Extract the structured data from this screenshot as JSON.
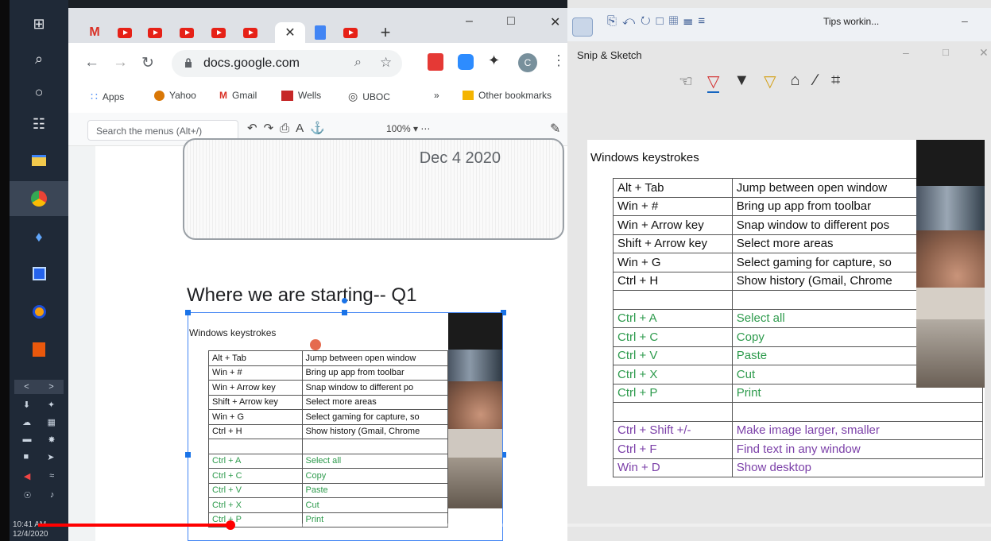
{
  "taskbar": {
    "icons": [
      "windows-start",
      "search",
      "cortana",
      "task-view",
      "file-explorer",
      "chrome",
      "app-blue",
      "app-notes",
      "app-headphones",
      "app-orange"
    ],
    "clock_time": "10:41 AM",
    "clock_date": "12/4/2020"
  },
  "chrome": {
    "url": "docs.google.com",
    "bookmarks": [
      "Apps",
      "Yahoo",
      "Gmail",
      "Wells",
      "UBOC",
      "»",
      "Other bookmarks"
    ],
    "avatar_letter": "C",
    "docs_search_placeholder": "Search the menus (Alt+/)",
    "zoom": "100%",
    "doc_date": "Dec 4 2020",
    "section_title": "Where we are starting-- Q1",
    "table_title": "Windows keystrokes"
  },
  "snip": {
    "app_title": "Snip & Sketch",
    "doc_tab_title": "Tips workin...",
    "heading": "Windows keystrokes"
  },
  "left_rows": [
    {
      "k": "Alt + Tab",
      "v": "Jump between open window",
      "c": "black"
    },
    {
      "k": "Win + #",
      "v": "Bring up app from toolbar",
      "c": "black"
    },
    {
      "k": "Win + Arrow key",
      "v": "Snap window to different po",
      "c": "black"
    },
    {
      "k": "Shift + Arrow key",
      "v": "Select more areas",
      "c": "black"
    },
    {
      "k": "Win + G",
      "v": "Select gaming for capture, so",
      "c": "black"
    },
    {
      "k": "Ctrl + H",
      "v": "Show history (Gmail, Chrome",
      "c": "black"
    },
    {
      "k": "",
      "v": "",
      "c": "black"
    },
    {
      "k": "Ctrl + A",
      "v": "Select all",
      "c": "green"
    },
    {
      "k": "Ctrl + C",
      "v": "Copy",
      "c": "green"
    },
    {
      "k": "Ctrl + V",
      "v": "Paste",
      "c": "green"
    },
    {
      "k": "Ctrl + X",
      "v": "Cut",
      "c": "green"
    },
    {
      "k": "Ctrl + P",
      "v": "Print",
      "c": "green"
    }
  ],
  "right_rows": [
    {
      "k": "Alt + Tab",
      "v": "Jump between open window",
      "c": "black"
    },
    {
      "k": "Win + #",
      "v": "Bring up app from toolbar",
      "c": "black"
    },
    {
      "k": "Win + Arrow key",
      "v": "Snap window to different pos",
      "c": "black"
    },
    {
      "k": "Shift + Arrow key",
      "v": "Select more areas",
      "c": "black"
    },
    {
      "k": "Win + G",
      "v": "Select gaming for capture, so",
      "c": "black"
    },
    {
      "k": "Ctrl + H",
      "v": "Show history (Gmail, Chrome",
      "c": "black"
    },
    {
      "k": "",
      "v": "",
      "c": "black"
    },
    {
      "k": "Ctrl + A",
      "v": "Select all",
      "c": "green"
    },
    {
      "k": "Ctrl + C",
      "v": "Copy",
      "c": "green"
    },
    {
      "k": "Ctrl + V",
      "v": "Paste",
      "c": "green"
    },
    {
      "k": "Ctrl + X",
      "v": "Cut",
      "c": "green"
    },
    {
      "k": "Ctrl + P",
      "v": "Print",
      "c": "green"
    },
    {
      "k": "",
      "v": "",
      "c": "black"
    },
    {
      "k": "Ctrl + Shift +/-",
      "v": "Make image larger, smaller",
      "c": "purple"
    },
    {
      "k": "Ctrl  + F",
      "v": "Find text in any window",
      "c": "purple"
    },
    {
      "k": "Win  + D",
      "v": "Show desktop",
      "c": "purple"
    }
  ],
  "video": {
    "progress": 0.2
  },
  "colors": {
    "youtube_red": "#e62117",
    "green_text": "#2e9b4d",
    "purple_text": "#7b3fa8",
    "selection_blue": "#1a73e8"
  }
}
